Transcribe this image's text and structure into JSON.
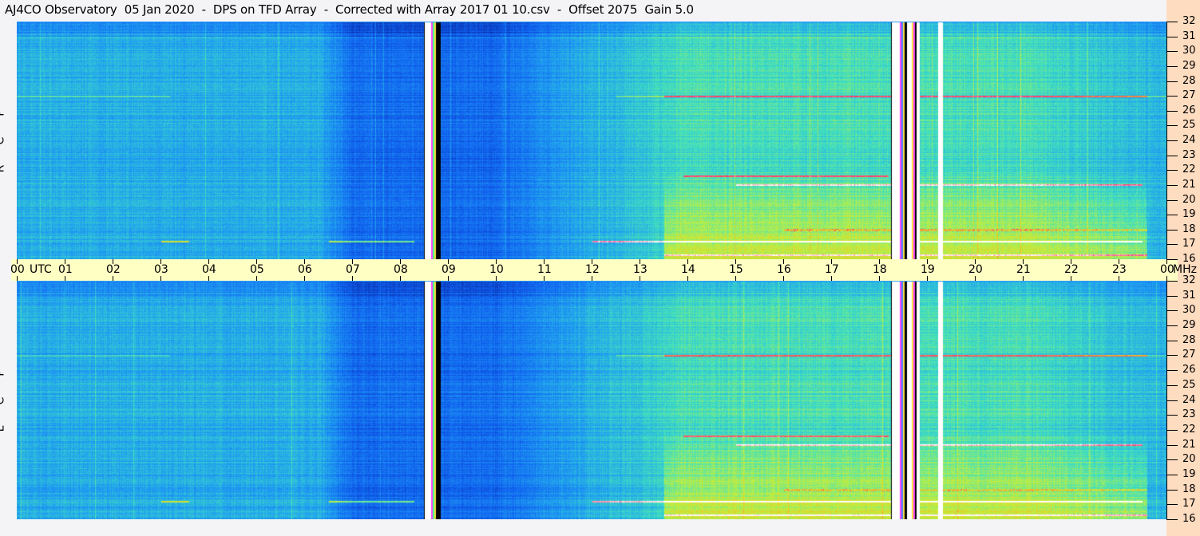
{
  "title": "AJ4CO Observatory  05 Jan 2020  -  DPS on TFD Array  -  Corrected with Array 2017 01 10.csv  -  Offset 2075  Gain 5.0",
  "chart_data": {
    "type": "heatmap",
    "title": "AJ4CO Observatory  05 Jan 2020  -  DPS on TFD Array  -  Corrected with Array 2017 01 10.csv  -  Offset 2075  Gain 5.0",
    "panels": [
      {
        "label": [
          "R",
          "C",
          "P"
        ]
      },
      {
        "label": [
          "L",
          "C",
          "P"
        ]
      }
    ],
    "x_axis": {
      "unit_label": "UTC",
      "range_hours": [
        0,
        24
      ],
      "ticks": [
        "00",
        "01",
        "02",
        "03",
        "04",
        "05",
        "06",
        "07",
        "08",
        "09",
        "10",
        "11",
        "12",
        "13",
        "14",
        "15",
        "16",
        "17",
        "18",
        "19",
        "20",
        "21",
        "22",
        "23",
        "00"
      ]
    },
    "y_axis": {
      "unit_label": "MHz",
      "range": [
        16,
        32
      ],
      "ticks": [
        "16",
        "17",
        "18",
        "19",
        "20",
        "21",
        "22",
        "23",
        "24",
        "25",
        "26",
        "27",
        "28",
        "29",
        "30",
        "31",
        "32"
      ]
    },
    "colormap": [
      "#000010",
      "#0828a0",
      "#1060f0",
      "#20a0f0",
      "#40e0c0",
      "#c0f040",
      "#f0c020",
      "#ff3070",
      "#ffffff"
    ],
    "data_gaps_utc": [
      [
        8.65,
        8.8
      ],
      [
        18.28,
        19.3
      ]
    ],
    "notable_interference_mhz": [
      27.0,
      21.6,
      21.0,
      18.0,
      17.2,
      16.3
    ]
  },
  "colors": {
    "time_band": "#ffffc4",
    "freq_axis_bg": "#fddcc0"
  }
}
